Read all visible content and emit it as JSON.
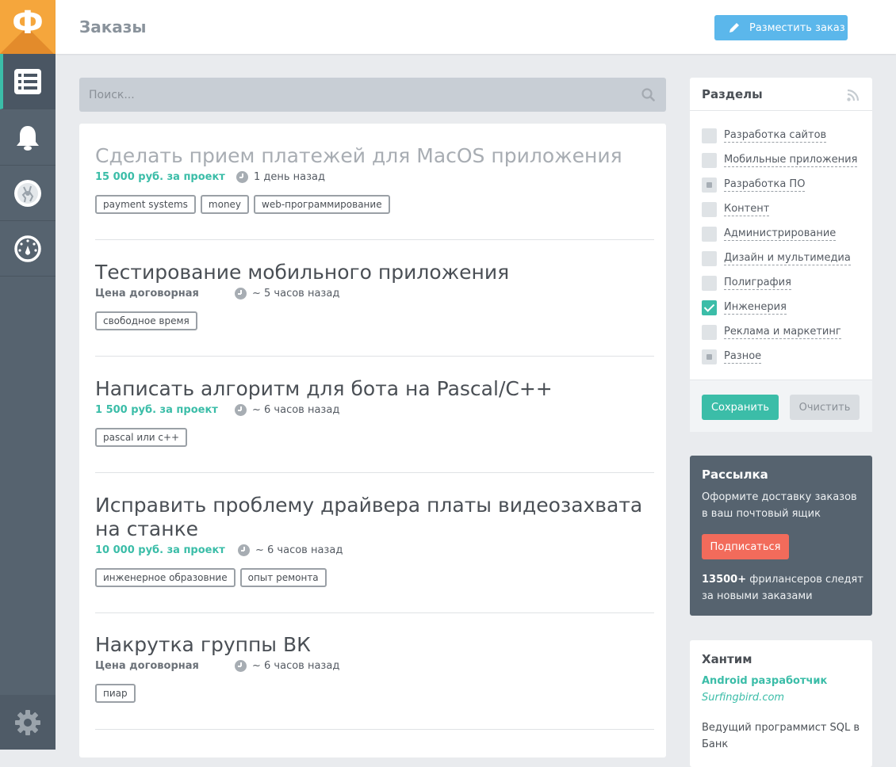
{
  "sidebar": {
    "logo": "Ф",
    "nav": [
      {
        "icon": "list-icon"
      },
      {
        "icon": "bell-icon"
      },
      {
        "icon": "robot-icon"
      },
      {
        "icon": "dashboard-icon"
      }
    ],
    "bottom_icon": "gear-icon"
  },
  "header": {
    "title": "Заказы",
    "place_order_label": "Разместить заказ"
  },
  "search": {
    "placeholder": "Поиск..."
  },
  "orders": [
    {
      "title": "Сделать прием платежей для MacOS приложения",
      "price": "15 000 руб. за проект",
      "time": "1 день назад",
      "tags": [
        "payment systems",
        "money",
        "web-программирование"
      ],
      "viewed": true
    },
    {
      "title": "Тестирование мобильного приложения",
      "price": "Цена договорная",
      "time": "~ 5 часов назад",
      "tags": [
        "свободное время"
      ],
      "viewed": false
    },
    {
      "title": "Написать алгоритм для бота на Pascal/C++",
      "price": "1 500 руб. за проект",
      "time": "~ 6 часов назад",
      "tags": [
        "pascal или c++"
      ],
      "viewed": false
    },
    {
      "title_line1": "Исправить проблему драйвера платы видеозахвата",
      "title_line2": "на станке",
      "price": "10 000 руб. за проект",
      "time": "~ 6 часов назад",
      "tags": [
        "инженерное образовние",
        "опыт ремонта"
      ],
      "viewed": false
    },
    {
      "title": "Накрутка группы ВК",
      "price": "Цена договорная",
      "time": "~ 6 часов назад",
      "tags": [
        "пиар"
      ],
      "viewed": false
    }
  ],
  "sections": {
    "title": "Разделы",
    "categories": [
      {
        "label": "Разработка сайтов",
        "state": "unchecked"
      },
      {
        "label": "Мобильные приложения",
        "state": "unchecked"
      },
      {
        "label": "Разработка ПО",
        "state": "partial"
      },
      {
        "label": "Контент",
        "state": "unchecked"
      },
      {
        "label": "Администрирование",
        "state": "unchecked"
      },
      {
        "label": "Дизайн и мультимедиа",
        "state": "unchecked"
      },
      {
        "label": "Полиграфия",
        "state": "unchecked"
      },
      {
        "label": "Инженерия",
        "state": "checked"
      },
      {
        "label": "Реклама и маркетинг",
        "state": "unchecked"
      },
      {
        "label": "Разное",
        "state": "partial"
      }
    ],
    "save_label": "Сохранить",
    "clear_label": "Очистить"
  },
  "newsletter": {
    "title": "Рассылка",
    "text": "Оформите доставку заказов в ваш почтовый ящик",
    "subscribe_label": "Подписаться",
    "stat_number": "13500+",
    "stat_text": " фрилансеров следят за новыми заказами"
  },
  "huntim": {
    "title": "Хантим",
    "job1_title": "Android разработчик",
    "job1_company": "Surfingbird.com",
    "job2_title": "Ведущий программист SQL в Банк"
  },
  "colors": {
    "accent": "#3bbda8",
    "brand": "#f5a63c",
    "primary_button": "#5bb7eb",
    "subscribe": "#f26b5b",
    "sidebar": "#56636f"
  }
}
